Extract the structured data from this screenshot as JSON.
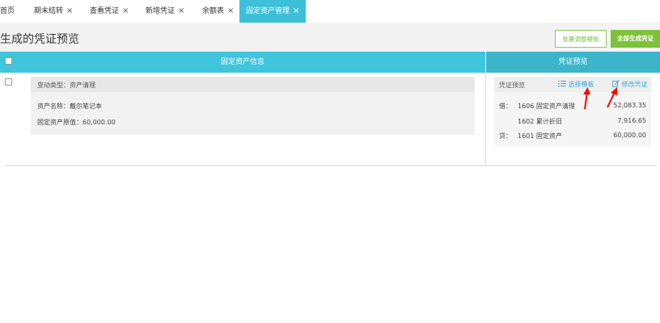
{
  "tabs": [
    {
      "label": "首页",
      "closable": false,
      "active": false
    },
    {
      "label": "期末结转",
      "closable": true,
      "active": false
    },
    {
      "label": "查看凭证",
      "closable": true,
      "active": false
    },
    {
      "label": "新增凭证",
      "closable": true,
      "active": false
    },
    {
      "label": "余额表",
      "closable": true,
      "active": false
    },
    {
      "label": "固定资产管理",
      "closable": true,
      "active": true
    }
  ],
  "close_glyph": "×",
  "header": {
    "title": "生成的凭证预览",
    "batch_template_label": "批量调整模板",
    "generate_all_label": "全部生成凭证"
  },
  "table": {
    "col_asset_info": "固定资产信息",
    "col_voucher_preview": "凭证预览"
  },
  "asset": {
    "change_type": "变动类型：资产清理",
    "asset_name": "资产名称：戴尔笔记本",
    "original_value": "固定资产原值：60,000.00"
  },
  "voucher": {
    "label": "凭证预览",
    "select_template_label": "选择模板",
    "edit_voucher_label": "修改凭证",
    "debit_label": "借：",
    "credit_label": "贷：",
    "entries": [
      {
        "account": "1606 固定资产清理",
        "amount": "52,083.35"
      },
      {
        "account": "1602 累计折旧",
        "amount": "7,916.65"
      },
      {
        "account": "1601 固定资产",
        "amount": "60,000.00"
      }
    ]
  },
  "colors": {
    "tab_active": "#3cc0d8",
    "header_left": "#3fc5dc",
    "header_right": "#3cb5cb",
    "btn_green": "#7cc23b",
    "link_blue": "#3ba8d8",
    "annotation_red": "#ff0000"
  },
  "icons": {
    "select_template": "list-icon",
    "edit_voucher": "edit-icon"
  }
}
